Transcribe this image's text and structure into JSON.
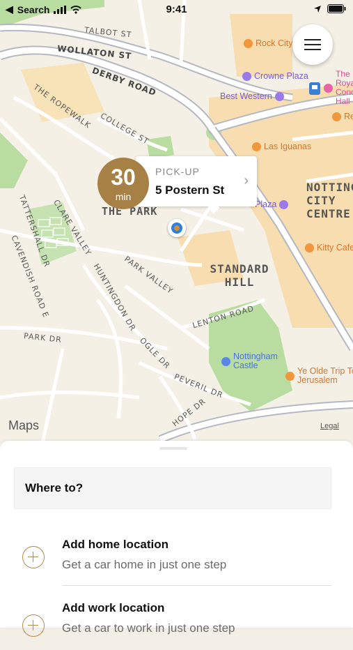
{
  "status_bar": {
    "back_label": "Search",
    "time": "9:41"
  },
  "map": {
    "streets": {
      "talbot": "TALBOT ST",
      "wollaton": "WOLLATON ST",
      "derby": "DERBY ROAD",
      "ropewalk": "THE ROPEWALK",
      "college": "COLLEGE ST",
      "tattershall": "TATTERSHALL DR",
      "clare_valley": "CLARE VALLEY",
      "cavendish": "CAVENDISH ROAD E",
      "huntingdon": "HUNTINGDON DR",
      "park_valley": "PARK VALLEY",
      "lenton": "LENTON ROAD",
      "park_dr": "PARK DR",
      "ogle": "OGLE DR",
      "peveril": "PEVERIL DR",
      "hope": "HOPE DR"
    },
    "areas": {
      "the_park": "THE PARK",
      "standard_hill": "STANDARD HILL",
      "nottingham_city_centre": "NOTTINGHAM CITY CENTRE"
    },
    "pois": {
      "rock_city": "Rock City",
      "crowne_plaza": "Crowne Plaza",
      "best_western": "Best Western",
      "royal_concert": "The Royal Concert Hall",
      "las_iguanas": "Las Iguanas",
      "restaurant": "Re...",
      "plaza": "Plaza",
      "kitty_cafe": "Kitty Cafe",
      "nottingham_castle": "Nottingham Castle",
      "ye_olde_trip": "Ye Olde Trip To Jerusalem"
    },
    "maps_logo": "Maps",
    "legal": "Legal"
  },
  "pickup": {
    "minutes": "30",
    "unit": "min",
    "label": "PICK-UP",
    "address": "5 Postern St"
  },
  "sheet": {
    "search_placeholder": "Where to?",
    "items": [
      {
        "title": "Add home location",
        "subtitle": "Get a car home in just one step"
      },
      {
        "title": "Add work location",
        "subtitle": "Get a car to work in just one step"
      }
    ]
  },
  "colors": {
    "accent": "#a78045",
    "park_green": "#b9dca0",
    "building_tan": "#f6d9a6",
    "road": "#ffffff",
    "major_road": "#b8bcc4"
  }
}
